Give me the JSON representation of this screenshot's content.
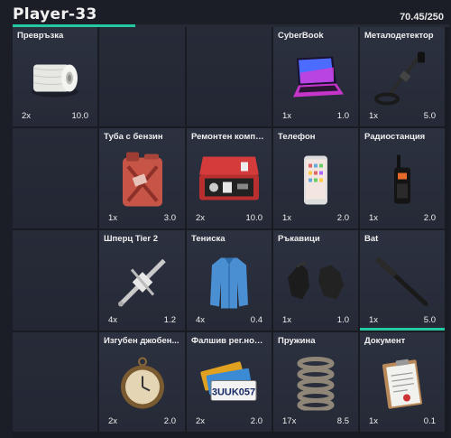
{
  "header": {
    "player_name": "Player-33",
    "weight_text": "70.45/250",
    "weight_fraction": 0.2818,
    "accent_color": "#23c9a3"
  },
  "slots": [
    {
      "name": "Превръзка",
      "qty": "2x",
      "weight": "10.0",
      "icon": "bandage-roll-icon"
    },
    {
      "empty": true
    },
    {
      "empty": true
    },
    {
      "name": "CyberBook",
      "qty": "1x",
      "weight": "1.0",
      "icon": "laptop-icon"
    },
    {
      "name": "Металодетектор",
      "qty": "1x",
      "weight": "5.0",
      "icon": "metal-detector-icon"
    },
    {
      "empty": true
    },
    {
      "name": "Туба с бензин",
      "qty": "1x",
      "weight": "3.0",
      "icon": "jerrycan-icon"
    },
    {
      "name": "Ремонтен компл...",
      "qty": "2x",
      "weight": "10.0",
      "icon": "repair-kit-icon"
    },
    {
      "name": "Телефон",
      "qty": "1x",
      "weight": "2.0",
      "icon": "phone-icon"
    },
    {
      "name": "Радиостанция",
      "qty": "1x",
      "weight": "2.0",
      "icon": "radio-icon"
    },
    {
      "empty": true
    },
    {
      "name": "Шперц Tier 2",
      "qty": "4x",
      "weight": "1.2",
      "icon": "lockpick-icon"
    },
    {
      "name": "Тениска",
      "qty": "4x",
      "weight": "0.4",
      "icon": "shirt-icon"
    },
    {
      "name": "Ръкавици",
      "qty": "1x",
      "weight": "1.0",
      "icon": "gloves-icon"
    },
    {
      "name": "Bat",
      "qty": "1x",
      "weight": "5.0",
      "icon": "bat-icon",
      "equipped": true
    },
    {
      "empty": true
    },
    {
      "name": "Изгубен джобен...",
      "qty": "2x",
      "weight": "2.0",
      "icon": "pocket-watch-icon"
    },
    {
      "name": "Фалшив рег.номер",
      "qty": "2x",
      "weight": "2.0",
      "icon": "license-plate-icon",
      "plate_text": "3UUK057"
    },
    {
      "name": "Пружина",
      "qty": "17x",
      "weight": "8.5",
      "icon": "spring-icon"
    },
    {
      "name": "Документ",
      "qty": "1x",
      "weight": "0.1",
      "icon": "document-icon"
    }
  ]
}
